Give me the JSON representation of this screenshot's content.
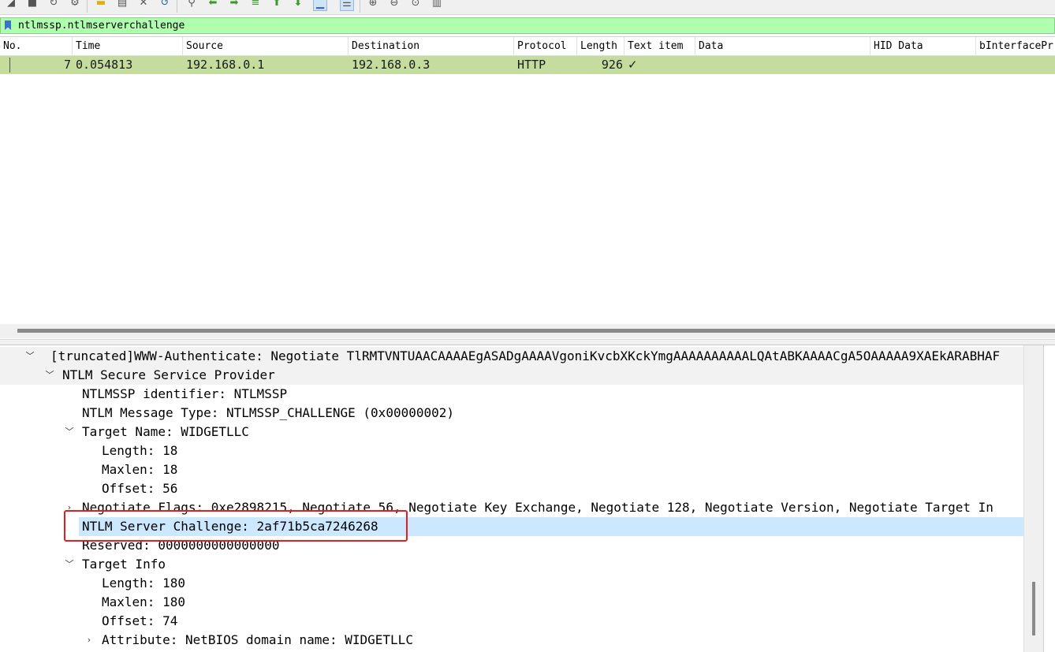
{
  "toolbar": {
    "icons": [
      "shark-fin-icon",
      "stop-icon",
      "restart-icon",
      "capture-options-icon",
      "open-file-icon",
      "save-file-icon",
      "close-file-icon",
      "reload-icon",
      "find-icon",
      "go-back-icon",
      "go-forward-icon",
      "go-to-packet-icon",
      "first-packet-icon",
      "last-packet-icon",
      "autoscroll-icon",
      "colorize-icon",
      "zoom-in-icon",
      "zoom-out-icon",
      "normal-size-icon",
      "resize-columns-icon"
    ]
  },
  "filter": {
    "value": "ntlmssp.ntlmserverchallenge",
    "background_color": "#afffaf"
  },
  "packet_list": {
    "columns": [
      "No.",
      "Time",
      "Source",
      "Destination",
      "Protocol",
      "Length",
      "Text item",
      "Data",
      "HID Data",
      "bInterfacePr"
    ],
    "rows": [
      {
        "no": "7",
        "time": "0.054813",
        "source": "192.168.0.1",
        "destination": "192.168.0.3",
        "protocol": "HTTP",
        "length": "926",
        "text_item": "✓",
        "data": "",
        "hid_data": "",
        "binterface": "",
        "row_color": "#c5dc9f"
      }
    ]
  },
  "details": {
    "rows": [
      {
        "text": "[truncated]WWW-Authenticate: Negotiate TlRMTVNTUAACAAAAEgASADgAAAAVgoniKvcbXKckYmgAAAAAAAAAALQAtABKAAAACgA5OAAAAA9XAEkARABHAF",
        "expander": "expanded"
      },
      {
        "text": "NTLM Secure Service Provider",
        "expander": "expanded"
      },
      {
        "text": "NTLMSSP identifier: NTLMSSP",
        "expander": "none"
      },
      {
        "text": "NTLM Message Type: NTLMSSP_CHALLENGE (0x00000002)",
        "expander": "none"
      },
      {
        "text": "Target Name: WIDGETLLC",
        "expander": "expanded"
      },
      {
        "text": "Length: 18",
        "expander": "none"
      },
      {
        "text": "Maxlen: 18",
        "expander": "none"
      },
      {
        "text": "Offset: 56",
        "expander": "none"
      },
      {
        "text": "Negotiate Flags: 0xe2898215, Negotiate 56, Negotiate Key Exchange, Negotiate 128, Negotiate Version, Negotiate Target In",
        "expander": "collapsed"
      },
      {
        "text": "NTLM Server Challenge: 2af71b5ca7246268",
        "expander": "none",
        "selected": true
      },
      {
        "text": "Reserved: 0000000000000000",
        "expander": "none"
      },
      {
        "text": "Target Info",
        "expander": "expanded"
      },
      {
        "text": "Length: 180",
        "expander": "none"
      },
      {
        "text": "Maxlen: 180",
        "expander": "none"
      },
      {
        "text": "Offset: 74",
        "expander": "none"
      },
      {
        "text": "Attribute: NetBIOS domain name: WIDGETLLC",
        "expander": "collapsed"
      }
    ],
    "selection_color": "#cce8ff",
    "annotation_color": "#e02020"
  }
}
